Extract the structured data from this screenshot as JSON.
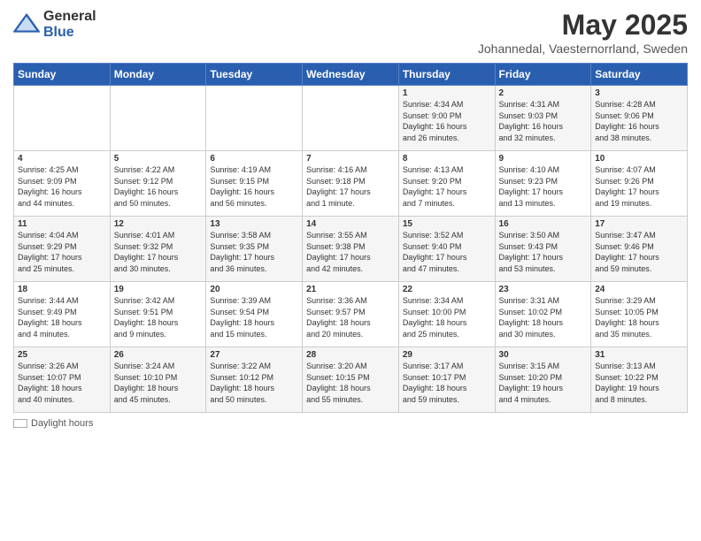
{
  "header": {
    "logo_general": "General",
    "logo_blue": "Blue",
    "title": "May 2025",
    "location": "Johannedal, Vaesternorrland, Sweden"
  },
  "days_of_week": [
    "Sunday",
    "Monday",
    "Tuesday",
    "Wednesday",
    "Thursday",
    "Friday",
    "Saturday"
  ],
  "weeks": [
    [
      {
        "day": "",
        "info": ""
      },
      {
        "day": "",
        "info": ""
      },
      {
        "day": "",
        "info": ""
      },
      {
        "day": "",
        "info": ""
      },
      {
        "day": "1",
        "info": "Sunrise: 4:34 AM\nSunset: 9:00 PM\nDaylight: 16 hours\nand 26 minutes."
      },
      {
        "day": "2",
        "info": "Sunrise: 4:31 AM\nSunset: 9:03 PM\nDaylight: 16 hours\nand 32 minutes."
      },
      {
        "day": "3",
        "info": "Sunrise: 4:28 AM\nSunset: 9:06 PM\nDaylight: 16 hours\nand 38 minutes."
      }
    ],
    [
      {
        "day": "4",
        "info": "Sunrise: 4:25 AM\nSunset: 9:09 PM\nDaylight: 16 hours\nand 44 minutes."
      },
      {
        "day": "5",
        "info": "Sunrise: 4:22 AM\nSunset: 9:12 PM\nDaylight: 16 hours\nand 50 minutes."
      },
      {
        "day": "6",
        "info": "Sunrise: 4:19 AM\nSunset: 9:15 PM\nDaylight: 16 hours\nand 56 minutes."
      },
      {
        "day": "7",
        "info": "Sunrise: 4:16 AM\nSunset: 9:18 PM\nDaylight: 17 hours\nand 1 minute."
      },
      {
        "day": "8",
        "info": "Sunrise: 4:13 AM\nSunset: 9:20 PM\nDaylight: 17 hours\nand 7 minutes."
      },
      {
        "day": "9",
        "info": "Sunrise: 4:10 AM\nSunset: 9:23 PM\nDaylight: 17 hours\nand 13 minutes."
      },
      {
        "day": "10",
        "info": "Sunrise: 4:07 AM\nSunset: 9:26 PM\nDaylight: 17 hours\nand 19 minutes."
      }
    ],
    [
      {
        "day": "11",
        "info": "Sunrise: 4:04 AM\nSunset: 9:29 PM\nDaylight: 17 hours\nand 25 minutes."
      },
      {
        "day": "12",
        "info": "Sunrise: 4:01 AM\nSunset: 9:32 PM\nDaylight: 17 hours\nand 30 minutes."
      },
      {
        "day": "13",
        "info": "Sunrise: 3:58 AM\nSunset: 9:35 PM\nDaylight: 17 hours\nand 36 minutes."
      },
      {
        "day": "14",
        "info": "Sunrise: 3:55 AM\nSunset: 9:38 PM\nDaylight: 17 hours\nand 42 minutes."
      },
      {
        "day": "15",
        "info": "Sunrise: 3:52 AM\nSunset: 9:40 PM\nDaylight: 17 hours\nand 47 minutes."
      },
      {
        "day": "16",
        "info": "Sunrise: 3:50 AM\nSunset: 9:43 PM\nDaylight: 17 hours\nand 53 minutes."
      },
      {
        "day": "17",
        "info": "Sunrise: 3:47 AM\nSunset: 9:46 PM\nDaylight: 17 hours\nand 59 minutes."
      }
    ],
    [
      {
        "day": "18",
        "info": "Sunrise: 3:44 AM\nSunset: 9:49 PM\nDaylight: 18 hours\nand 4 minutes."
      },
      {
        "day": "19",
        "info": "Sunrise: 3:42 AM\nSunset: 9:51 PM\nDaylight: 18 hours\nand 9 minutes."
      },
      {
        "day": "20",
        "info": "Sunrise: 3:39 AM\nSunset: 9:54 PM\nDaylight: 18 hours\nand 15 minutes."
      },
      {
        "day": "21",
        "info": "Sunrise: 3:36 AM\nSunset: 9:57 PM\nDaylight: 18 hours\nand 20 minutes."
      },
      {
        "day": "22",
        "info": "Sunrise: 3:34 AM\nSunset: 10:00 PM\nDaylight: 18 hours\nand 25 minutes."
      },
      {
        "day": "23",
        "info": "Sunrise: 3:31 AM\nSunset: 10:02 PM\nDaylight: 18 hours\nand 30 minutes."
      },
      {
        "day": "24",
        "info": "Sunrise: 3:29 AM\nSunset: 10:05 PM\nDaylight: 18 hours\nand 35 minutes."
      }
    ],
    [
      {
        "day": "25",
        "info": "Sunrise: 3:26 AM\nSunset: 10:07 PM\nDaylight: 18 hours\nand 40 minutes."
      },
      {
        "day": "26",
        "info": "Sunrise: 3:24 AM\nSunset: 10:10 PM\nDaylight: 18 hours\nand 45 minutes."
      },
      {
        "day": "27",
        "info": "Sunrise: 3:22 AM\nSunset: 10:12 PM\nDaylight: 18 hours\nand 50 minutes."
      },
      {
        "day": "28",
        "info": "Sunrise: 3:20 AM\nSunset: 10:15 PM\nDaylight: 18 hours\nand 55 minutes."
      },
      {
        "day": "29",
        "info": "Sunrise: 3:17 AM\nSunset: 10:17 PM\nDaylight: 18 hours\nand 59 minutes."
      },
      {
        "day": "30",
        "info": "Sunrise: 3:15 AM\nSunset: 10:20 PM\nDaylight: 19 hours\nand 4 minutes."
      },
      {
        "day": "31",
        "info": "Sunrise: 3:13 AM\nSunset: 10:22 PM\nDaylight: 19 hours\nand 8 minutes."
      }
    ]
  ],
  "footer": {
    "daylight_label": "Daylight hours"
  }
}
